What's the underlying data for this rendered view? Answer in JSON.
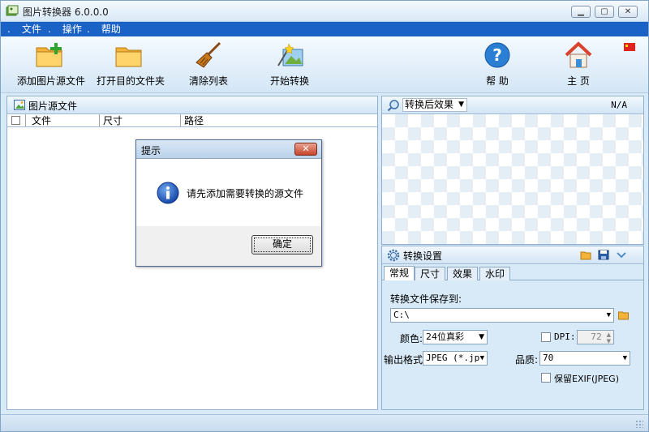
{
  "window": {
    "title": "图片转换器 6.0.0.0"
  },
  "menu": [
    {
      "dot": ".",
      "label": "文件"
    },
    {
      "dot": ".",
      "label": "操作"
    },
    {
      "dot": ".",
      "label": "帮助"
    }
  ],
  "toolbar": {
    "add_source": "添加图片源文件",
    "open_target": "打开目的文件夹",
    "clear_list": "清除列表",
    "start_convert": "开始转换",
    "help": "帮 助",
    "home": "主 页"
  },
  "source_panel": {
    "title": "图片源文件",
    "columns": [
      "文件",
      "尺寸",
      "路径"
    ]
  },
  "preview_panel": {
    "mode": "转换后效果",
    "size_readout": "N/A"
  },
  "settings": {
    "title": "转换设置",
    "tabs": [
      "常规",
      "尺寸",
      "效果",
      "水印"
    ],
    "active_tab": "常规",
    "save_to_label": "转换文件保存到:",
    "save_path": "C:\\",
    "color_label": "颜色:",
    "color_value": "24位真彩",
    "dpi_label": "DPI:",
    "dpi_value": "72",
    "format_label": "输出格式:",
    "format_value": "JPEG (*.jpg",
    "quality_label": "品质:",
    "quality_value": "70",
    "exif_label": "保留EXIF(JPEG)"
  },
  "dialog": {
    "title": "提示",
    "message": "请先添加需要转换的源文件",
    "ok": "确定",
    "close": "✕"
  },
  "colors": {
    "menubar": "#1b62c6",
    "window_bg": "#d8eaf8",
    "panel_border": "#8fb0cf"
  }
}
